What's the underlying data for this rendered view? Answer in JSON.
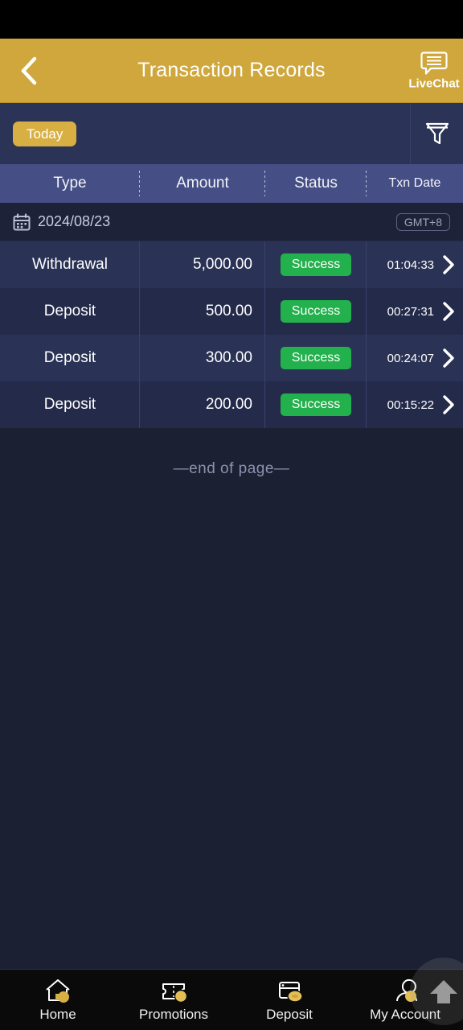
{
  "header": {
    "title": "Transaction Records",
    "back_icon": "chevron-left-icon",
    "livechat_label": "LiveChat",
    "livechat_icon": "chat-bubble-icon",
    "bg_color": "#cfa73c"
  },
  "filter_bar": {
    "chip_label": "Today",
    "chip_color": "#d8af42",
    "filter_icon": "funnel-icon"
  },
  "table": {
    "columns": [
      {
        "label": "Type"
      },
      {
        "label": "Amount"
      },
      {
        "label": "Status"
      },
      {
        "label": "Txn Date"
      }
    ],
    "date_group": {
      "calendar_icon": "calendar-icon",
      "date": "2024/08/23",
      "timezone_badge": "GMT+8"
    },
    "rows": [
      {
        "type": "Withdrawal",
        "amount": "5,000.00",
        "status": "Success",
        "time": "01:04:33",
        "chevron": "chevron-right-icon"
      },
      {
        "type": "Deposit",
        "amount": "500.00",
        "status": "Success",
        "time": "00:27:31",
        "chevron": "chevron-right-icon"
      },
      {
        "type": "Deposit",
        "amount": "300.00",
        "status": "Success",
        "time": "00:24:07",
        "chevron": "chevron-right-icon"
      },
      {
        "type": "Deposit",
        "amount": "200.00",
        "status": "Success",
        "time": "00:15:22",
        "chevron": "chevron-right-icon"
      }
    ],
    "status_color": "#22b14c",
    "end_of_page": "—end of page—"
  },
  "bottom_nav": {
    "items": [
      {
        "label": "Home",
        "icon": "home-icon"
      },
      {
        "label": "Promotions",
        "icon": "ticket-coin-icon"
      },
      {
        "label": "Deposit",
        "icon": "card-coin-icon"
      },
      {
        "label": "My Account",
        "icon": "user-coin-icon"
      }
    ],
    "scroll_top_icon": "arrow-up-icon"
  }
}
